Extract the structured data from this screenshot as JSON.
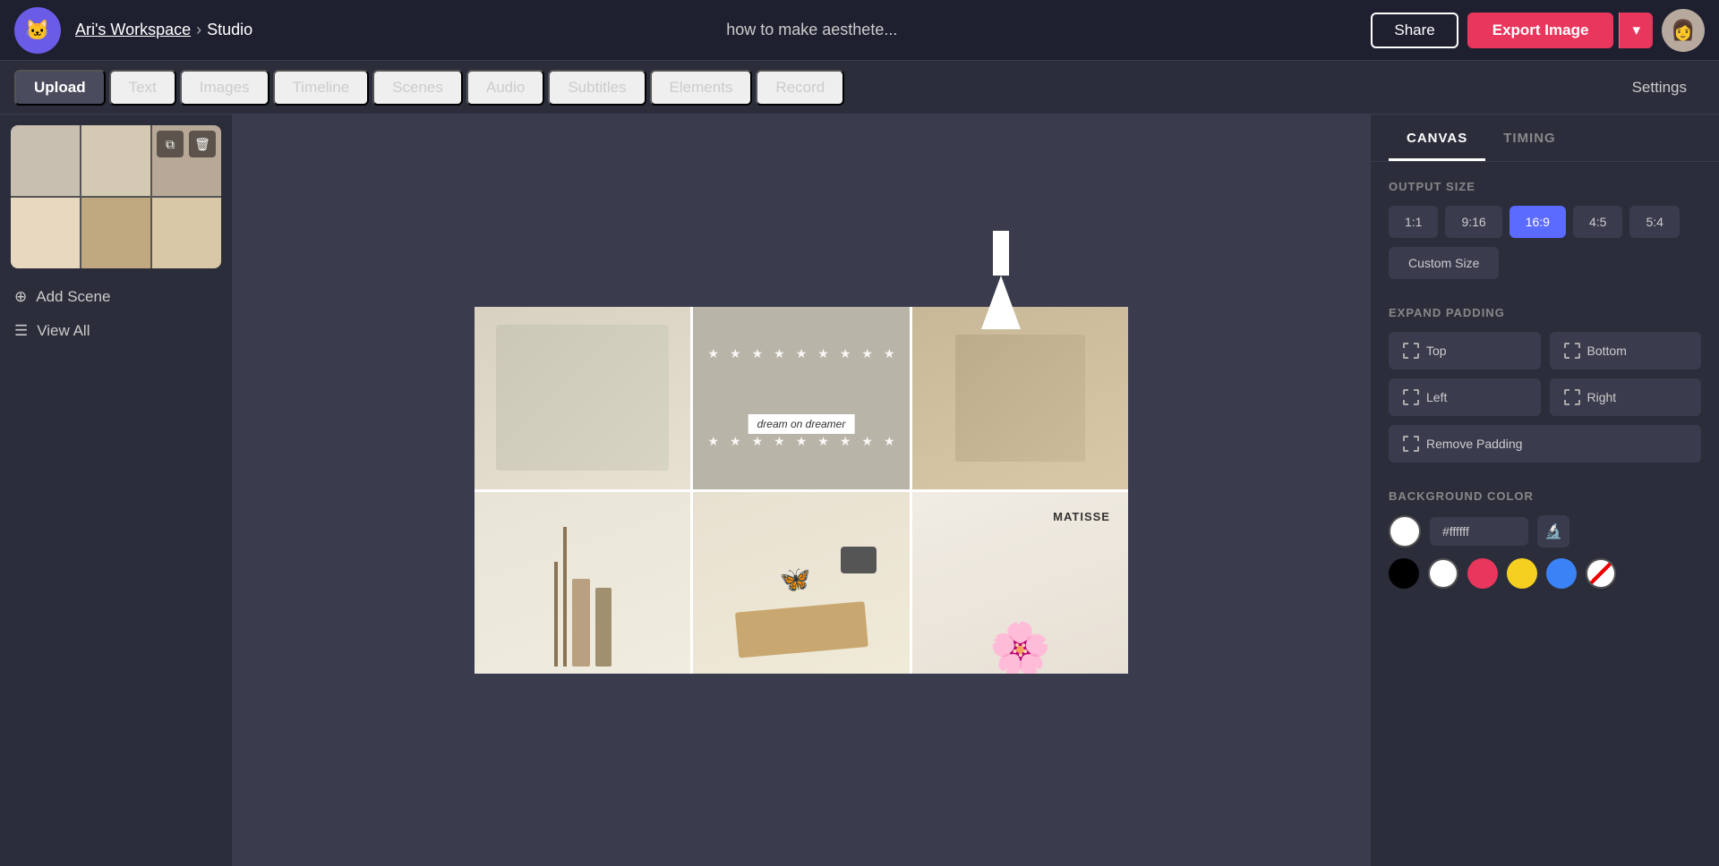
{
  "topbar": {
    "logo_emoji": "🐱",
    "workspace_name": "Ari's Workspace",
    "separator": "›",
    "studio_label": "Studio",
    "title_value": "how to make aesthete...",
    "title_placeholder": "how to make aesthete...",
    "share_label": "Share",
    "export_label": "Export Image",
    "export_chevron": "▾"
  },
  "navbar": {
    "items": [
      {
        "id": "upload",
        "label": "Upload",
        "active": true
      },
      {
        "id": "text",
        "label": "Text",
        "active": false
      },
      {
        "id": "images",
        "label": "Images",
        "active": false
      },
      {
        "id": "timeline",
        "label": "Timeline",
        "active": false
      },
      {
        "id": "scenes",
        "label": "Scenes",
        "active": false
      },
      {
        "id": "audio",
        "label": "Audio",
        "active": false
      },
      {
        "id": "subtitles",
        "label": "Subtitles",
        "active": false
      },
      {
        "id": "elements",
        "label": "Elements",
        "active": false
      },
      {
        "id": "record",
        "label": "Record",
        "active": false
      }
    ],
    "settings_label": "Settings"
  },
  "sidebar": {
    "copy_icon": "⧉",
    "trash_icon": "🗑",
    "add_scene_label": "Add Scene",
    "view_all_label": "View All",
    "add_icon": "⊕",
    "list_icon": "☰"
  },
  "canvas": {
    "dream_label": "dream on dreamer",
    "matisse_label": "MATISSE",
    "arrow_visible": true
  },
  "right_panel": {
    "tabs": [
      {
        "id": "canvas",
        "label": "CANVAS",
        "active": true
      },
      {
        "id": "timing",
        "label": "TIMING",
        "active": false
      }
    ],
    "output_size": {
      "title": "OUTPUT SIZE",
      "options": [
        {
          "id": "1x1",
          "label": "1:1",
          "active": false
        },
        {
          "id": "9x16",
          "label": "9:16",
          "active": false
        },
        {
          "id": "16x9",
          "label": "16:9",
          "active": true
        },
        {
          "id": "4x5",
          "label": "4:5",
          "active": false
        },
        {
          "id": "5x4",
          "label": "5:4",
          "active": false
        }
      ],
      "custom_label": "Custom Size"
    },
    "expand_padding": {
      "title": "EXPAND PADDING",
      "buttons": [
        {
          "id": "top",
          "label": "Top"
        },
        {
          "id": "bottom",
          "label": "Bottom"
        },
        {
          "id": "left",
          "label": "Left"
        },
        {
          "id": "right",
          "label": "Right"
        }
      ],
      "remove_label": "Remove Padding"
    },
    "background_color": {
      "title": "BACKGROUND COLOR",
      "hex_value": "#ffffff",
      "hex_placeholder": "#ffffff",
      "presets": [
        {
          "id": "black",
          "color": "#000000"
        },
        {
          "id": "white",
          "color": "#ffffff"
        },
        {
          "id": "red",
          "color": "#e8365d"
        },
        {
          "id": "yellow",
          "color": "#f5d020"
        },
        {
          "id": "blue",
          "color": "#3b82f6"
        },
        {
          "id": "none",
          "color": "none"
        }
      ]
    }
  }
}
